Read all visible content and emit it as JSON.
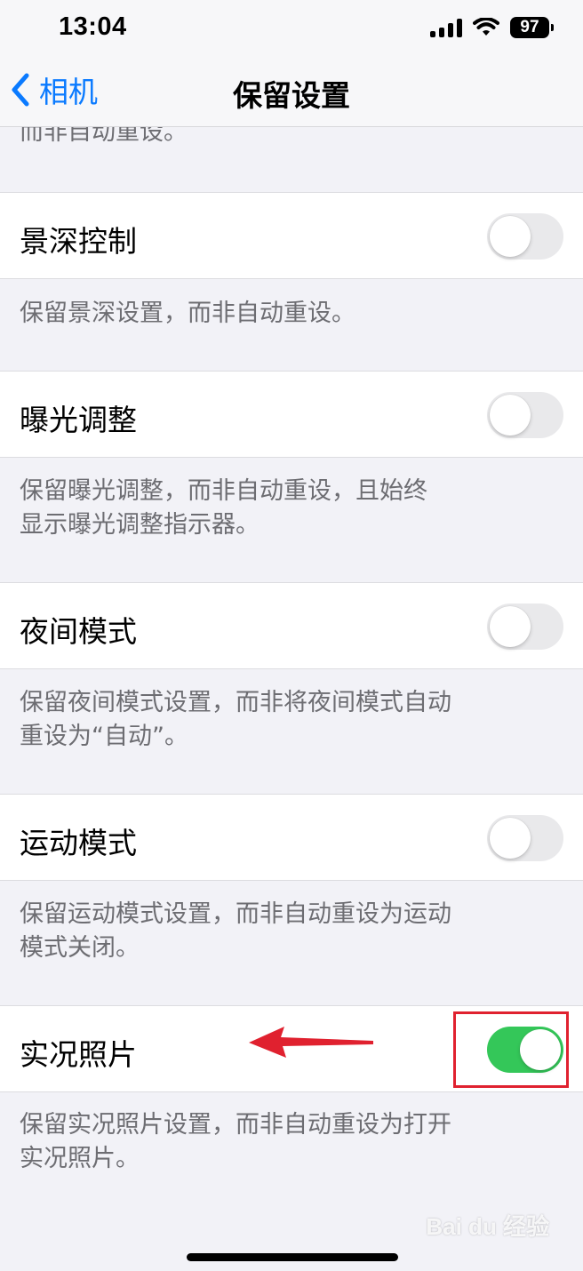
{
  "status_bar": {
    "time": "13:04",
    "battery": "97"
  },
  "nav": {
    "back_label": "相机",
    "title": "保留设置"
  },
  "truncated_footer": "而非自动重设。",
  "settings": [
    {
      "label": "景深控制",
      "on": false,
      "footer": [
        "保留景深设置，而非自动重设。"
      ]
    },
    {
      "label": "曝光调整",
      "on": false,
      "footer": [
        "保留曝光调整，而非自动重设，且始终",
        "显示曝光调整指示器。"
      ]
    },
    {
      "label": "夜间模式",
      "on": false,
      "footer": [
        "保留夜间模式设置，而非将夜间模式自动",
        "重设为“自动”。"
      ]
    },
    {
      "label": "运动模式",
      "on": false,
      "footer": [
        "保留运动模式设置，而非自动重设为运动",
        "模式关闭。"
      ]
    },
    {
      "label": "实况照片",
      "on": true,
      "footer": [
        "保留实况照片设置，而非自动重设为打开",
        "实况照片。"
      ]
    }
  ],
  "colors": {
    "accent": "#0a7aff",
    "toggle_on": "#34c759",
    "annotation": "#e0212f"
  },
  "watermark": "Bai du 经验"
}
